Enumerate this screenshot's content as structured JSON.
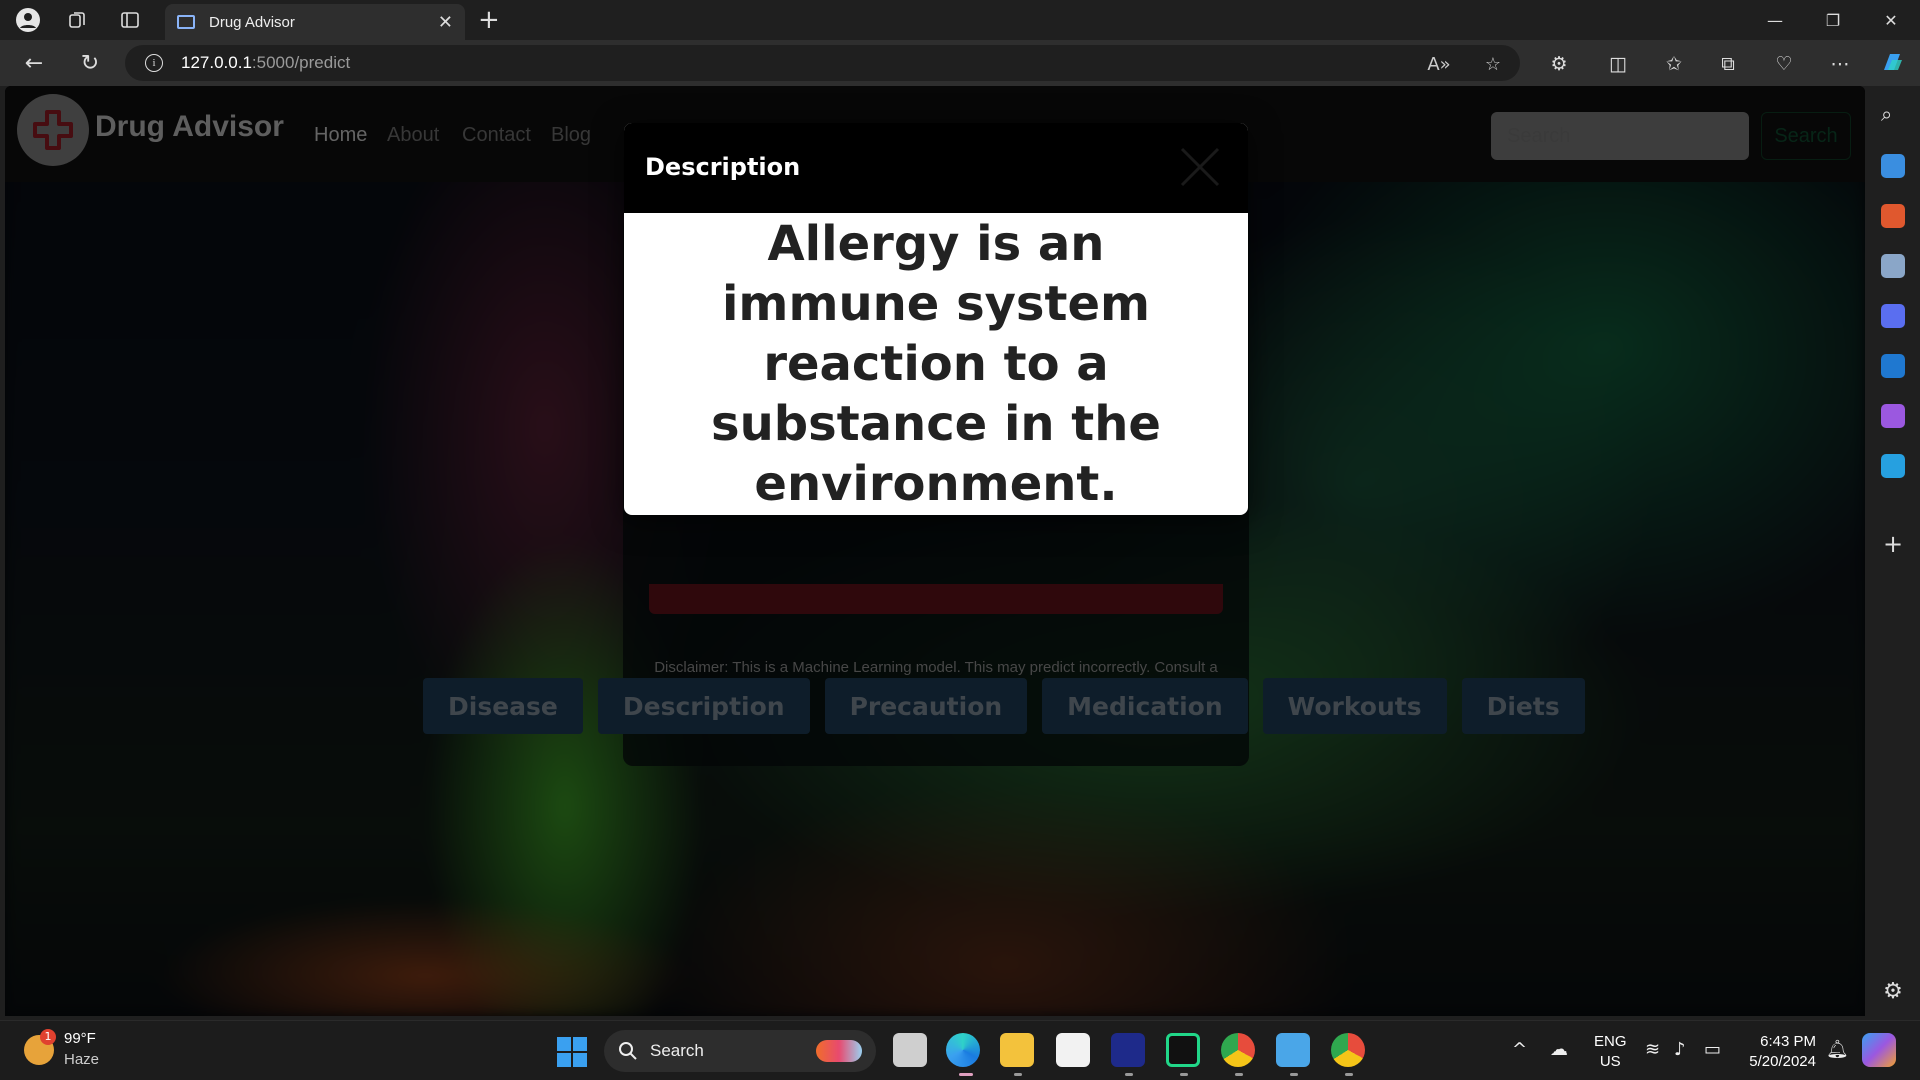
{
  "browser": {
    "tab_title": "Drug Advisor",
    "url_host": "127.0.0.1",
    "url_path": ":5000/predict"
  },
  "site": {
    "brand": "Drug Advisor",
    "nav": [
      {
        "label": "Home",
        "active": true
      },
      {
        "label": "About",
        "active": false
      },
      {
        "label": "Contact",
        "active": false
      },
      {
        "label": "Blog",
        "active": false
      }
    ],
    "search_placeholder": "Search",
    "search_button": "Search"
  },
  "form": {
    "disclaimer": "Disclaimer: This is a Machine Learning model. This may predict incorrectly. Consult a Doctor before."
  },
  "result_buttons": [
    "Disease",
    "Description",
    "Precaution",
    "Medication",
    "Workouts",
    "Diets"
  ],
  "modal": {
    "title": "Description",
    "body": "Allergy is an immune system reaction to a substance in the environment."
  },
  "taskbar": {
    "weather_badge": "1",
    "weather_temp": "99°F",
    "weather_desc": "Haze",
    "search_label": "Search",
    "lang_top": "ENG",
    "lang_bottom": "US",
    "time": "6:43 PM",
    "date": "5/20/2024"
  },
  "colors": {
    "modal_header": "#000000",
    "result_button": "#1c3a55",
    "predict_button": "#5e1019",
    "accent": "#3aa0f0"
  }
}
